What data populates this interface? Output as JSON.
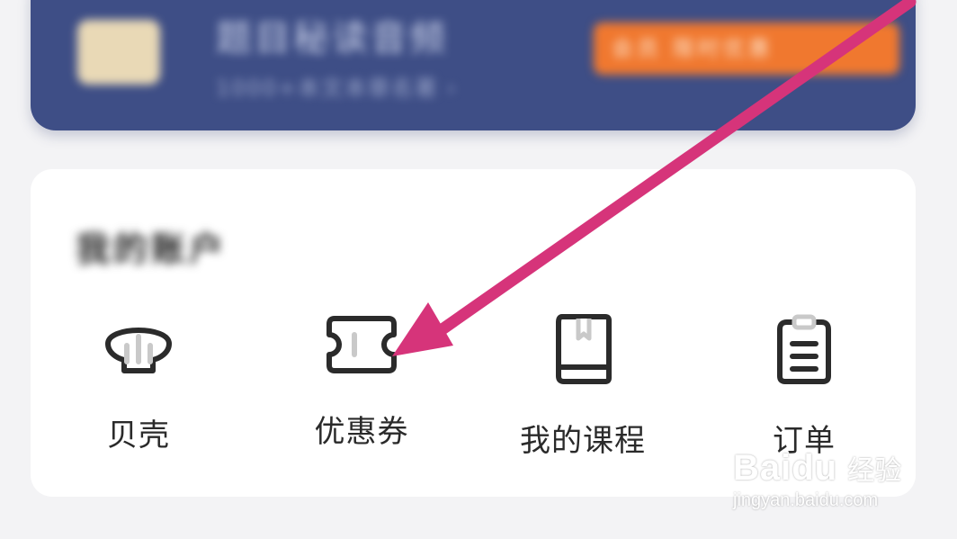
{
  "banner": {
    "title": "题目秘读音频",
    "subtitle": "1000+本文本章名著 ›",
    "pill": "会员 限时优惠"
  },
  "account": {
    "section_title": "我的账户",
    "items": [
      {
        "label": "贝壳",
        "icon": "shell-icon"
      },
      {
        "label": "优惠券",
        "icon": "coupon-icon"
      },
      {
        "label": "我的课程",
        "icon": "book-icon"
      },
      {
        "label": "订单",
        "icon": "clipboard-icon"
      }
    ]
  },
  "annotation": {
    "arrow_color": "#d6347a"
  },
  "watermark": {
    "logo_text": "Baidu",
    "logo_cn": "经验",
    "url": "jingyan.baidu.com"
  }
}
